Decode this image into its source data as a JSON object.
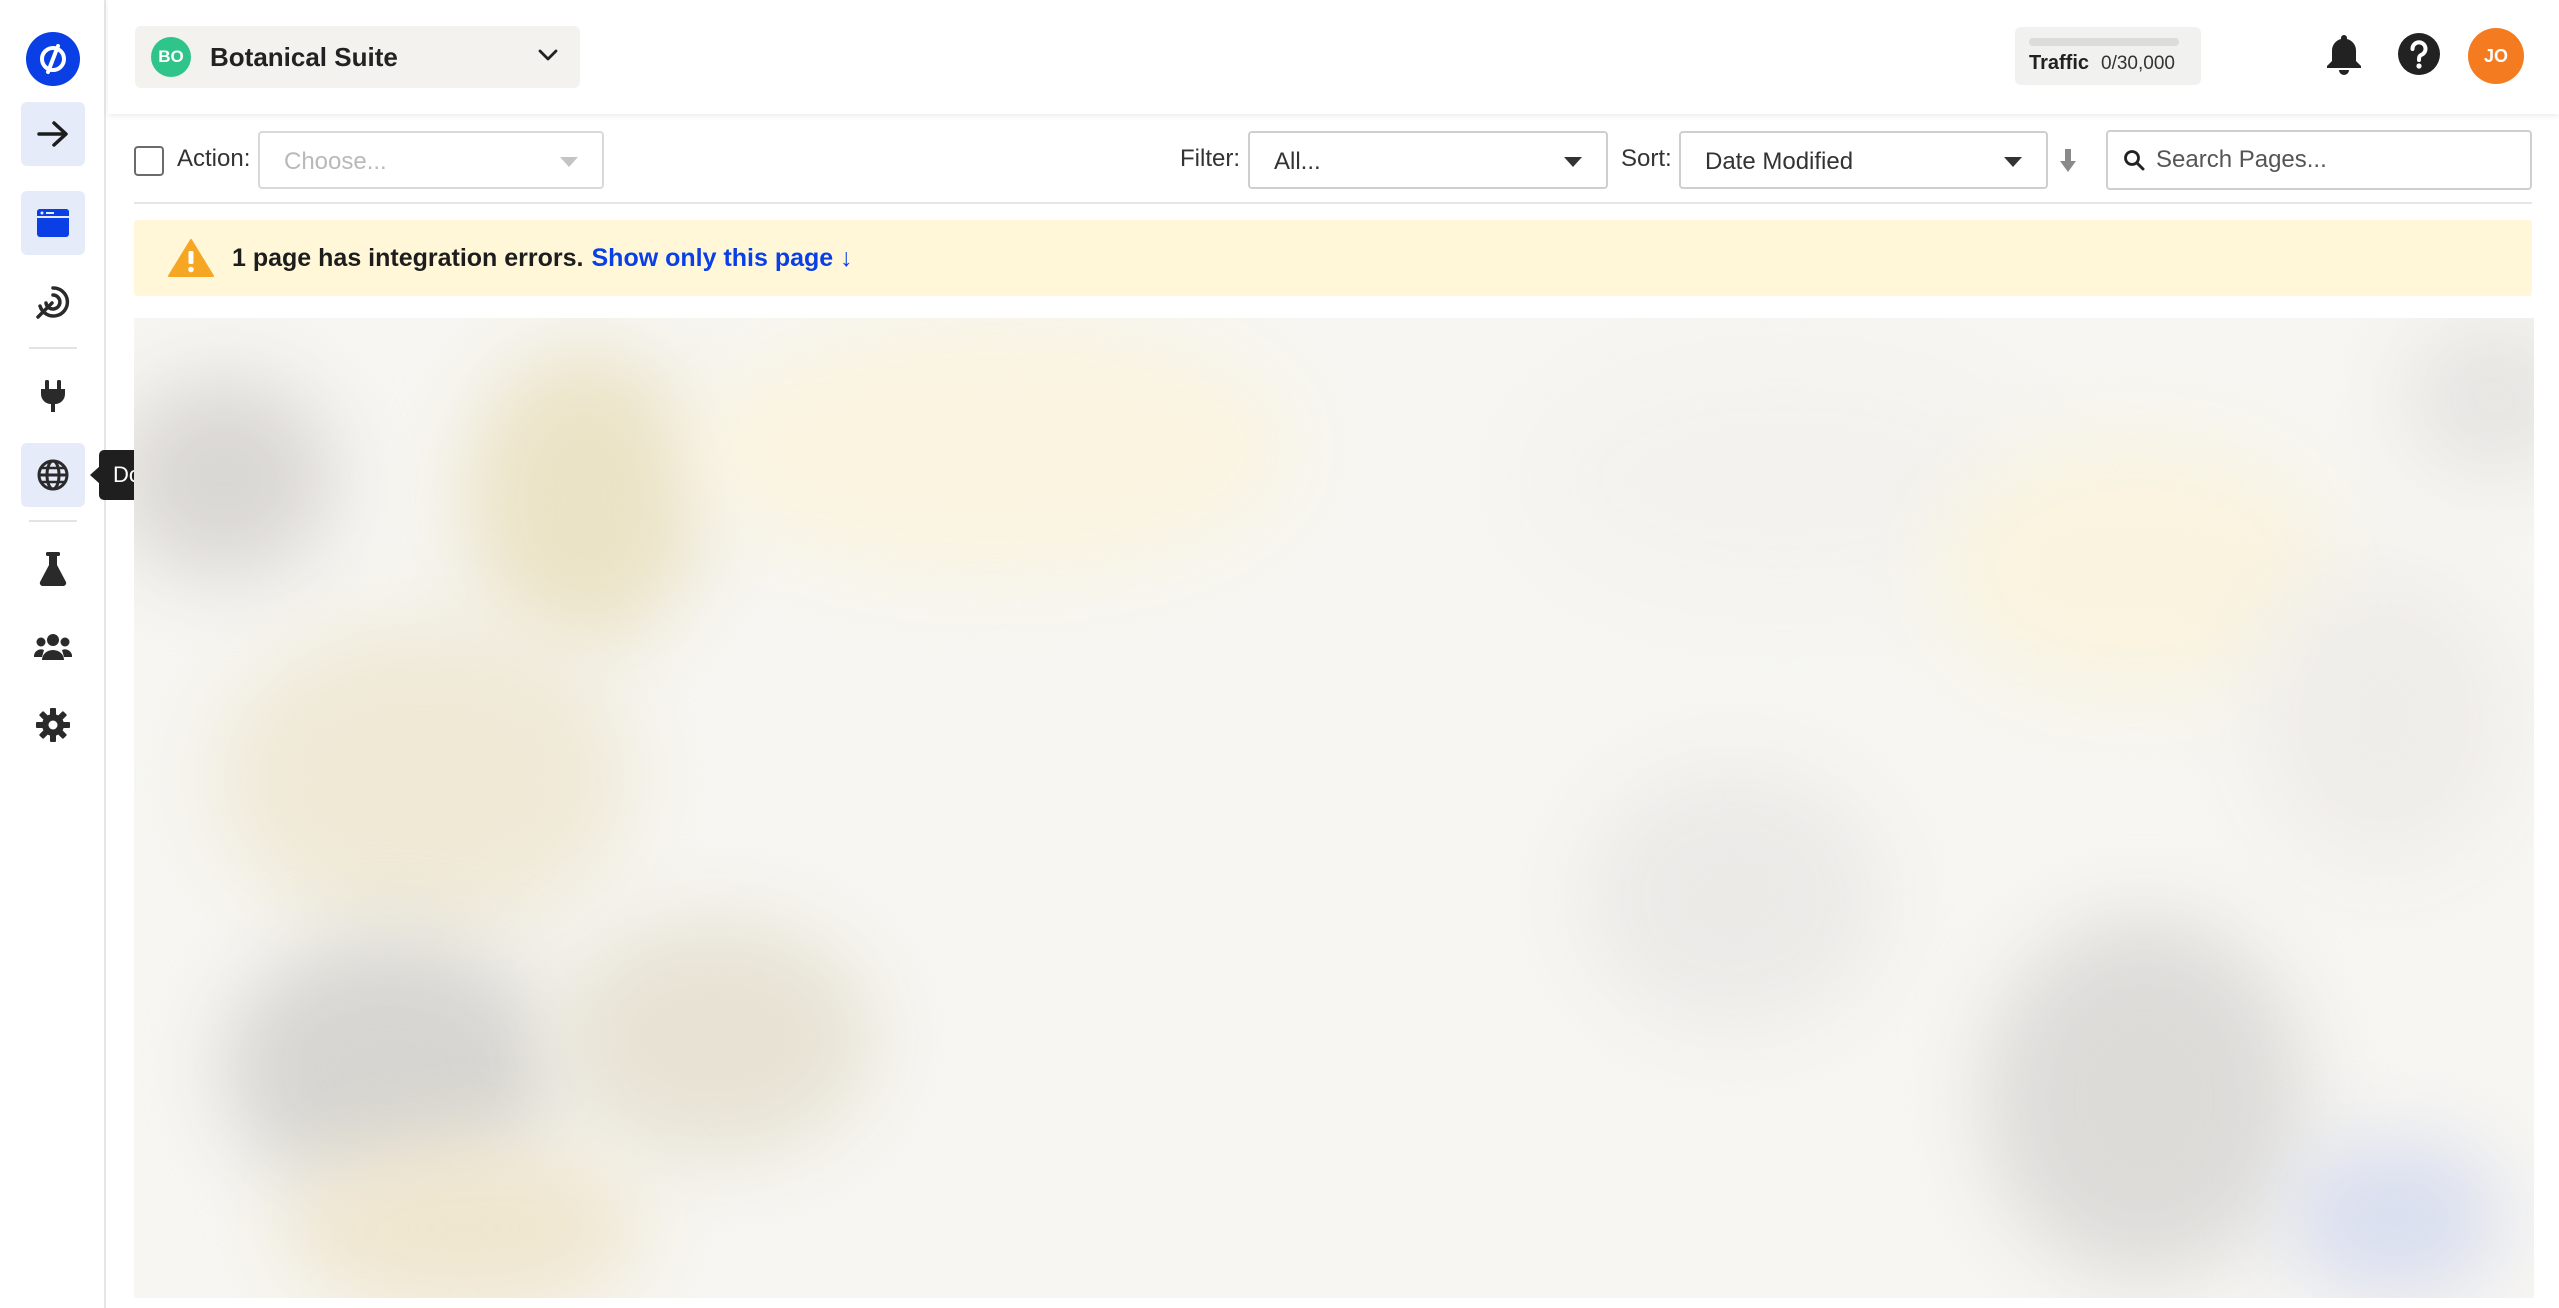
{
  "rail": {
    "items": [
      {
        "name": "collapse-toggle",
        "icon": "arrow-right-icon"
      },
      {
        "name": "landing-pages",
        "icon": "browser-window-icon"
      },
      {
        "name": "conversions",
        "icon": "target-icon"
      },
      {
        "name": "integrations",
        "icon": "plug-icon"
      },
      {
        "name": "domains",
        "icon": "globe-icon"
      },
      {
        "name": "experiments",
        "icon": "flask-icon"
      },
      {
        "name": "team",
        "icon": "users-icon"
      },
      {
        "name": "settings",
        "icon": "gear-icon"
      }
    ],
    "tooltip": "Do"
  },
  "header": {
    "workspace": {
      "initials": "BO",
      "name": "Botanical Suite",
      "color": "#2fc48a"
    },
    "traffic": {
      "label": "Traffic",
      "value": "0/30,000",
      "used_fraction": 0
    },
    "avatar": {
      "initials": "JO",
      "color": "#f47b20"
    }
  },
  "toolbar": {
    "action_label": "Action:",
    "action_placeholder": "Choose...",
    "filter_label": "Filter:",
    "filter_value": "All...",
    "sort_label": "Sort:",
    "sort_value": "Date Modified",
    "search_placeholder": "Search Pages..."
  },
  "alert": {
    "message": "1 page has integration errors.",
    "link": "Show only this page ↓"
  },
  "colors": {
    "brand": "#0a3fe6",
    "alert_bg": "#fff7d8",
    "warning": "#f5a623"
  }
}
